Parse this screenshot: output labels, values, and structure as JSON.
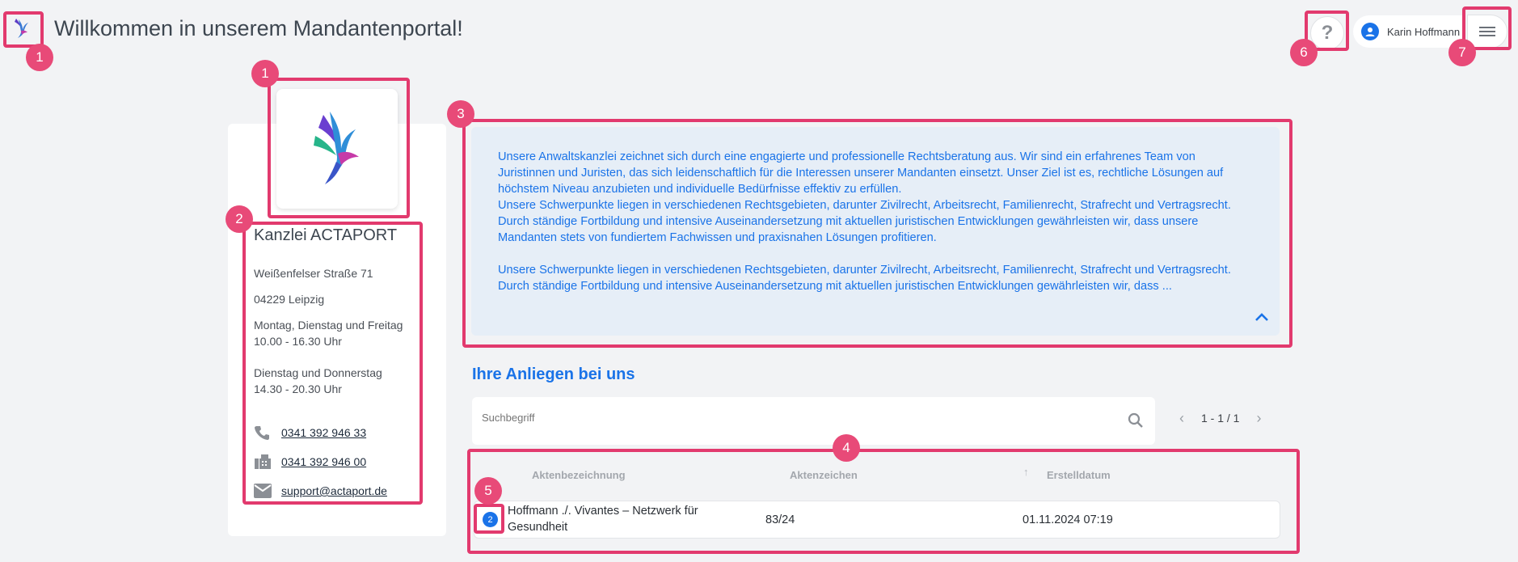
{
  "header": {
    "title": "Willkommen in unserem Mandantenportal!",
    "help_label": "?",
    "user_name": "Karin Hoffmann"
  },
  "firm": {
    "name": "Kanzlei ACTAPORT",
    "street": "Weißenfelser Straße 71",
    "city": "04229 Leipzig",
    "hours_1_days": "Montag, Dienstag und Freitag",
    "hours_1_time": "10.00 - 16.30 Uhr",
    "hours_2_days": "Dienstag und Donnerstag",
    "hours_2_time": "14.30 - 20.30 Uhr",
    "phone": "0341 392 946 33",
    "fax": "0341 392 946 00",
    "email": "support@actaport.de"
  },
  "description": {
    "paragraph_1": "Unsere Anwaltskanzlei zeichnet sich durch eine engagierte und professionelle Rechtsberatung aus. Wir sind ein erfahrenes Team von Juristinnen und Juristen, das sich leidenschaftlich für die Interessen unserer Mandanten einsetzt. Unser Ziel ist es, rechtliche Lösungen auf höchstem Niveau anzubieten und individuelle Bedürfnisse effektiv zu erfüllen.\nUnsere Schwerpunkte liegen in verschiedenen Rechtsgebieten, darunter Zivilrecht, Arbeitsrecht, Familienrecht, Strafrecht und Vertragsrecht. Durch ständige Fortbildung und intensive Auseinandersetzung mit aktuellen juristischen Entwicklungen gewährleisten wir, dass unsere Mandanten stets von fundiertem Fachwissen und praxisnahen Lösungen profitieren.",
    "paragraph_2": "Unsere Schwerpunkte liegen in verschiedenen Rechtsgebieten, darunter Zivilrecht, Arbeitsrecht, Familienrecht, Strafrecht und Vertragsrecht. Durch ständige Fortbildung und intensive Auseinandersetzung mit aktuellen juristischen Entwicklungen gewährleisten wir, dass ..."
  },
  "matters": {
    "title": "Ihre Anliegen bei uns",
    "search_placeholder": "Suchbegriff",
    "pagination": "1 - 1 / 1",
    "columns": [
      "Aktenbezeichnung",
      "Aktenzeichen",
      "Erstelldatum"
    ],
    "rows": [
      {
        "badge": "2",
        "name": "Hoffmann ./. Vivantes – Netzwerk für Gesundheit",
        "file_no": "83/24",
        "created": "01.11.2024 07:19"
      }
    ]
  },
  "annotations": [
    "1",
    "1",
    "2",
    "3",
    "4",
    "5",
    "6",
    "7"
  ],
  "colors": {
    "accent": "#1a73e8",
    "highlight": "#e23a6e",
    "badge": "#e84a78",
    "description_bg": "#e6eef7"
  }
}
